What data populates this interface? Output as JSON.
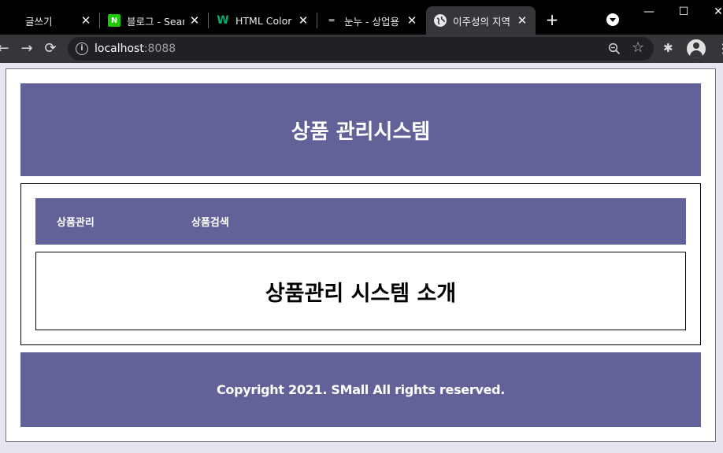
{
  "browser": {
    "tabs": [
      {
        "title": "글쓰기",
        "favicon": "none"
      },
      {
        "title": "블로그 - Sear",
        "favicon": "naver-icon"
      },
      {
        "title": "HTML Color P",
        "favicon": "w3-icon"
      },
      {
        "title": "눈누 - 상업용",
        "favicon": "noonnu-icon"
      },
      {
        "title": "이주성의 지역",
        "favicon": "globe-icon",
        "active": true
      }
    ],
    "close_glyph": "✕",
    "new_tab_glyph": "+",
    "url_host": "localhost",
    "url_port": ":8088"
  },
  "page": {
    "header_title": "상품 관리시스템",
    "nav": {
      "product_manage": "상품관리",
      "product_search": "상품검색"
    },
    "intro_title": "상품관리 시스템 소개",
    "footer_text": "Copyright 2021. SMall All rights reserved."
  },
  "colors": {
    "accent": "#626299",
    "tabbar": "#000000",
    "toolbar": "#35363a"
  }
}
